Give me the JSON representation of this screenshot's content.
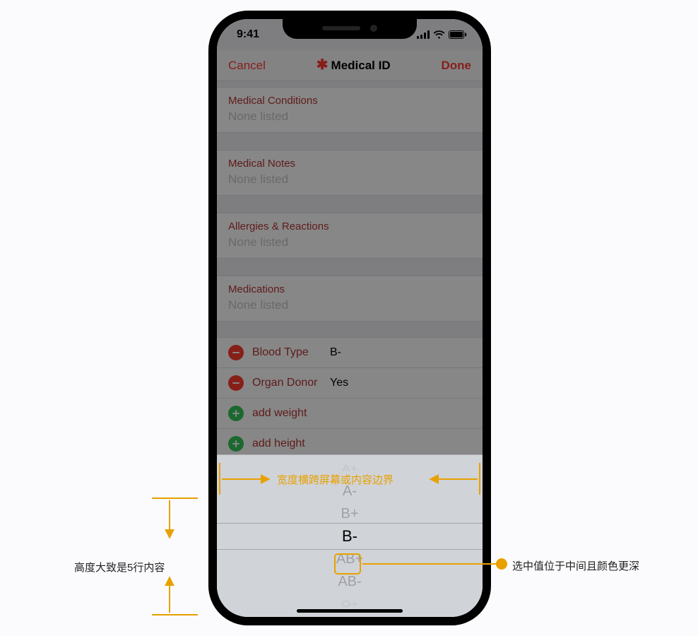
{
  "statusbar": {
    "time": "9:41"
  },
  "navbar": {
    "cancel": "Cancel",
    "done": "Done",
    "title": "Medical ID"
  },
  "sections": {
    "conditions": {
      "label": "Medical Conditions",
      "value": "None listed"
    },
    "notes": {
      "label": "Medical Notes",
      "value": "None listed"
    },
    "allergies": {
      "label": "Allergies & Reactions",
      "value": "None listed"
    },
    "medications": {
      "label": "Medications",
      "value": "None listed"
    }
  },
  "rows": {
    "blood_type": {
      "label": "Blood Type",
      "value": "B-"
    },
    "organ_donor": {
      "label": "Organ Donor",
      "value": "Yes"
    },
    "add_weight": {
      "label": "add weight"
    },
    "add_height": {
      "label": "add height"
    }
  },
  "picker": {
    "items": [
      "A+",
      "A-",
      "B+",
      "B-",
      "AB+",
      "AB-",
      "O+"
    ],
    "selected_index": 3
  },
  "annotations": {
    "width_span": "宽度横跨屏幕或内容边界",
    "height_rows": "高度大致是5行内容",
    "selected_desc": "选中值位于中间且颜色更深"
  }
}
